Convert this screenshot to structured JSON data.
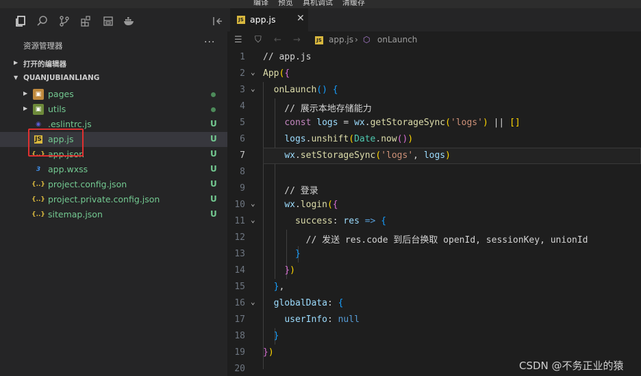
{
  "top_menu": [
    "编译",
    "预览",
    "真机调试",
    "清缓存"
  ],
  "sidebar": {
    "title": "资源管理器",
    "more": "···",
    "sections": [
      {
        "label": "打开的编辑器",
        "expanded": false
      },
      {
        "label": "QUANJUBIANLIANG",
        "expanded": true
      }
    ],
    "files": [
      {
        "name": "pages",
        "kind": "folder",
        "status": "dot"
      },
      {
        "name": "utils",
        "kind": "folder",
        "status": "dot"
      },
      {
        "name": ".eslintrc.js",
        "kind": "eslint",
        "status": "U"
      },
      {
        "name": "app.js",
        "kind": "js",
        "status": "U"
      },
      {
        "name": "app.json",
        "kind": "json",
        "status": "U"
      },
      {
        "name": "app.wxss",
        "kind": "wxss",
        "status": "U"
      },
      {
        "name": "project.config.json",
        "kind": "json",
        "status": "U"
      },
      {
        "name": "project.private.config.json",
        "kind": "json",
        "status": "U"
      },
      {
        "name": "sitemap.json",
        "kind": "json",
        "status": "U"
      }
    ]
  },
  "editor": {
    "tab": {
      "label": "app.js",
      "close": "✕",
      "icon": "JS"
    },
    "breadcrumb": {
      "file": "app.js",
      "symbol": "onLaunch",
      "sep": "›"
    },
    "active_line": 7
  },
  "code_lines": [
    "// app.js",
    "App({",
    "  onLaunch() {",
    "    // 展示本地存储能力",
    "    const logs = wx.getStorageSync('logs') || []",
    "    logs.unshift(Date.now())",
    "    wx.setStorageSync('logs', logs)",
    "",
    "    // 登录",
    "    wx.login({",
    "      success: res => {",
    "        // 发送 res.code 到后台换取 openId, sessionKey, unionId",
    "      }",
    "    })",
    "  },",
    "  globalData: {",
    "    userInfo: null",
    "  }",
    "})",
    ""
  ],
  "line_numbers": [
    "1",
    "2",
    "3",
    "4",
    "5",
    "6",
    "7",
    "8",
    "9",
    "10",
    "11",
    "12",
    "13",
    "14",
    "15",
    "16",
    "17",
    "18",
    "19",
    "20"
  ],
  "watermark": "CSDN @不务正业的猿",
  "colors": {
    "added_file": "#73c991",
    "highlight_box": "#e03030",
    "comment": "#6a9955",
    "function": "#dcdcaa",
    "string": "#ce9178"
  }
}
